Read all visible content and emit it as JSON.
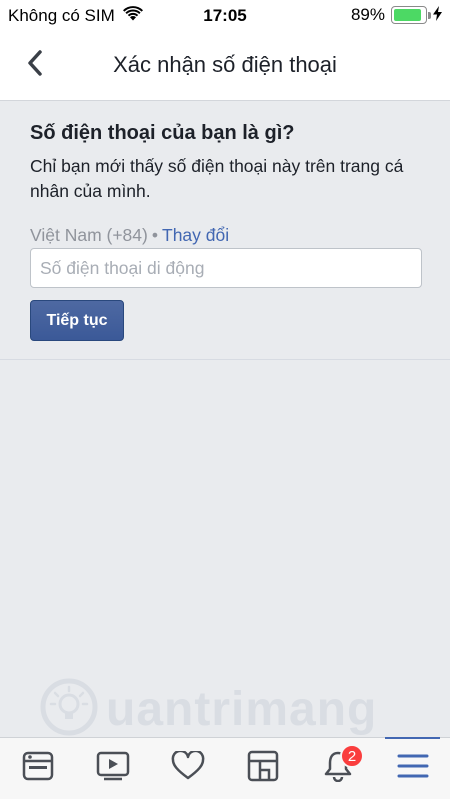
{
  "status_bar": {
    "carrier": "Không có SIM",
    "time": "17:05",
    "battery": "89%",
    "battery_level": 0.89,
    "colors": {
      "battery_fill": "#4cd964"
    }
  },
  "nav": {
    "title": "Xác nhận số điện thoại",
    "back_icon": "chevron-left-icon"
  },
  "form": {
    "heading": "Số điện thoại của bạn là gì?",
    "description": "Chỉ bạn mới thấy số điện thoại này trên trang cá nhân của mình.",
    "country": "Việt Nam (+84)",
    "separator": "•",
    "change_link": "Thay đổi",
    "phone_placeholder": "Số điện thoại di động",
    "phone_value": "",
    "continue_label": "Tiếp tục",
    "colors": {
      "button": "#4267b2",
      "link": "#4267b2"
    }
  },
  "watermark": {
    "text": "uantrimang"
  },
  "tab_bar": {
    "tabs": [
      {
        "name": "news-feed",
        "icon": "news-feed-icon"
      },
      {
        "name": "video",
        "icon": "video-play-icon"
      },
      {
        "name": "dating",
        "icon": "heart-icon"
      },
      {
        "name": "marketplace",
        "icon": "marketplace-icon"
      },
      {
        "name": "notifications",
        "icon": "bell-icon",
        "badge": "2"
      },
      {
        "name": "menu",
        "icon": "hamburger-menu-icon",
        "active": true
      }
    ],
    "badge_color": "#fa3e3e"
  }
}
